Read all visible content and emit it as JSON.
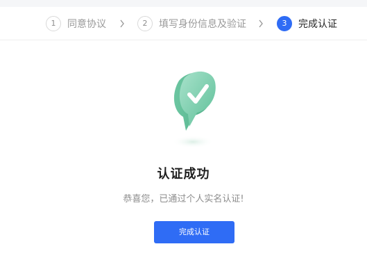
{
  "steps": [
    {
      "number": "1",
      "label": "同意协议",
      "state": "done"
    },
    {
      "number": "2",
      "label": "填写身份信息及验证",
      "state": "done"
    },
    {
      "number": "3",
      "label": "完成认证",
      "state": "active"
    }
  ],
  "step_separator_icon": "chevron-right-icon",
  "result": {
    "icon": "check-bubble-icon",
    "title": "认证成功",
    "subtitle": "恭喜您，已通过个人实名认证!"
  },
  "actions": {
    "done_label": "完成认证"
  },
  "colors": {
    "primary": "#2f6cf5",
    "success_green": "#7ccfb0",
    "muted_text": "#8c8c8c"
  }
}
